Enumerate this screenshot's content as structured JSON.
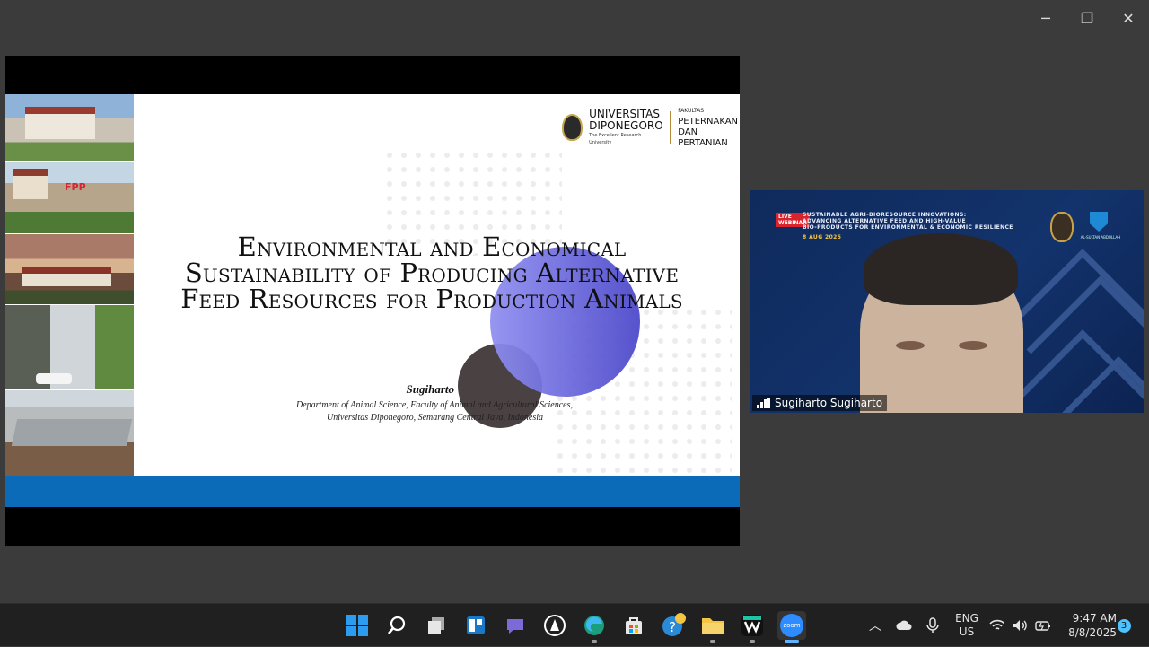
{
  "window": {
    "minimize_label": "─",
    "restore_label": "❐",
    "close_label": "✕"
  },
  "slide": {
    "title": "Environmental and Economical Sustainability of Producing Alternative Feed Resources for Production Animals",
    "author": "Sugiharto",
    "affiliation_line1": "Department of Animal Science, Faculty of Animal and Agricultural Sciences,",
    "affiliation_line2": "Universitas Diponegoro, Semarang Central Java, Indonesia",
    "logo_univ_line1": "UNIVERSITAS",
    "logo_univ_line2": "DIPONEGORO",
    "logo_tagline": "The Excellent Research University",
    "logo_fak_small": "FAKULTAS",
    "logo_fak_line1": "PETERNAKAN",
    "logo_fak_line2": "DAN PERTANIAN",
    "photo_sign": "FPP",
    "accent_band_color": "#0b6bb8"
  },
  "video": {
    "participant_name": "Sugiharto Sugiharto",
    "banner_live": "LIVE",
    "banner_webinar": "WEBINAR",
    "banner_line1": "SUSTAINABLE AGRI-BIORESOURCE INNOVATIONS:",
    "banner_line2": "ADVANCING ALTERNATIVE FEED AND HIGH-VALUE",
    "banner_line3": "BIO-PRODUCTS FOR ENVIRONMENTAL & ECONOMIC RESILIENCE",
    "banner_date": "8 AUG 2025",
    "partner_logo_text": "AL-SULTAN ABDULLAH"
  },
  "taskbar": {
    "zoom_label": "zoom",
    "lang_line1": "ENG",
    "lang_line2": "US",
    "time": "9:47 AM",
    "date": "8/8/2025",
    "notification_count": "3"
  }
}
